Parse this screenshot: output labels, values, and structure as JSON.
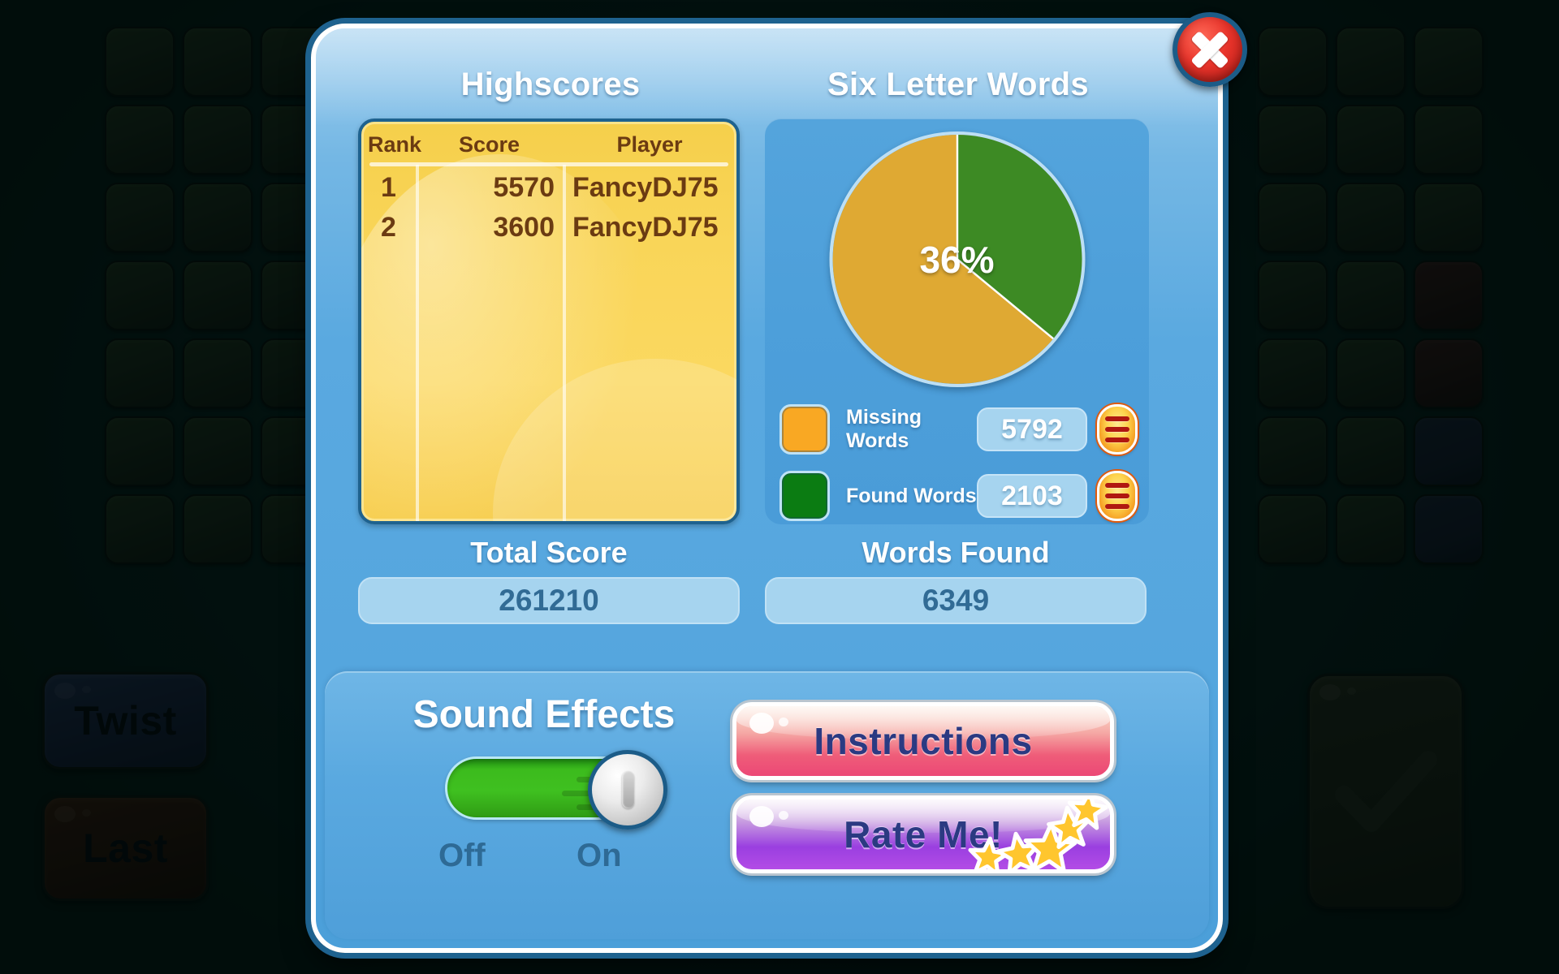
{
  "background": {
    "buttons": [
      {
        "name": "twist",
        "label": "Twist"
      },
      {
        "name": "last",
        "label": "Last"
      },
      {
        "name": "submit-check",
        "label": ""
      }
    ]
  },
  "dialog": {
    "close_label": "✕",
    "highscores": {
      "title": "Highscores",
      "columns": [
        "Rank",
        "Score",
        "Player"
      ],
      "rows": [
        {
          "rank": "1",
          "score": "5570",
          "player": "FancyDJ75"
        },
        {
          "rank": "2",
          "score": "3600",
          "player": "FancyDJ75"
        }
      ]
    },
    "mode": {
      "title": "Six Letter Words",
      "legend": [
        {
          "label": "Missing Words",
          "value": "5792",
          "color": "#f9a823",
          "list_icon": "list-icon"
        },
        {
          "label": "Found Words",
          "value": "2103",
          "color": "#0b7c12",
          "list_icon": "list-icon"
        }
      ]
    },
    "totals": [
      {
        "caption": "Total Score",
        "value": "261210"
      },
      {
        "caption": "Words Found",
        "value": "6349"
      }
    ],
    "sound": {
      "title": "Sound Effects",
      "off_label": "Off",
      "on_label": "On",
      "state": "On"
    },
    "actions": [
      {
        "name": "instructions",
        "label": "Instructions"
      },
      {
        "name": "rate-me",
        "label": "Rate Me!"
      }
    ]
  },
  "chart_data": {
    "type": "pie",
    "title": "Six Letter Words",
    "labels": [
      "Found Words",
      "Missing Words"
    ],
    "values": [
      2103,
      5792
    ],
    "percentages": [
      36,
      64
    ],
    "center_label": "36%",
    "colors": [
      "#3d8a24",
      "#dfa933"
    ],
    "legend_position": "bottom",
    "start_angle_deg": 0,
    "direction": "clockwise"
  }
}
